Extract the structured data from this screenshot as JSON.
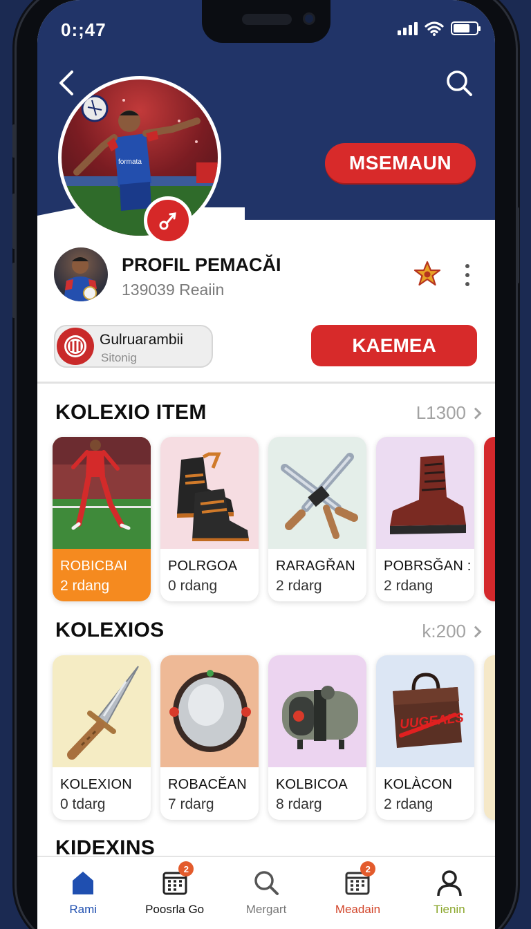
{
  "status_bar": {
    "time": "0:;47"
  },
  "header": {
    "follow_label": "MSEMAUN"
  },
  "profile": {
    "name": "PROFIL PEMACĂI",
    "subtitle": "139039 Reaiin",
    "group_title": "Gulruaгambii",
    "group_subtitle": "Sitonig",
    "primary_action": "KAEMEA"
  },
  "sections": [
    {
      "title": "KOLEXIO ITEM",
      "link": "L1300",
      "items": [
        {
          "name": "ROBICBAI",
          "meta": "2 rdang",
          "icon": "football-player-image"
        },
        {
          "name": "POLRGOA",
          "meta": "0 rdang",
          "icon": "boots-icon"
        },
        {
          "name": "RARAGŘAN",
          "meta": "2 rdarg",
          "icon": "crossed-swords-icon"
        },
        {
          "name": "POBRSĞAN :",
          "meta": "2 rdang",
          "icon": "boot-icon"
        }
      ]
    },
    {
      "title": "KOLEXIOS",
      "link": "k:200",
      "items": [
        {
          "name": "KOLEXION",
          "meta": "0 tdarg",
          "icon": "dagger-icon"
        },
        {
          "name": "ROBACĚAN",
          "meta": "7 rdarg",
          "icon": "shield-icon"
        },
        {
          "name": "KOLBICOA",
          "meta": "8 rdarg",
          "icon": "gadget-icon"
        },
        {
          "name": "KOLÀCON",
          "meta": "2 rdang",
          "icon": "bag-icon"
        }
      ]
    },
    {
      "title": "KIDEXINS"
    }
  ],
  "bag_print": "UUGEALS",
  "bottom_nav": [
    {
      "label": "Rami",
      "color": "#1f4fb0",
      "icon": "home-icon"
    },
    {
      "label": "Poosrla Go",
      "color": "#111111",
      "icon": "calendar-icon",
      "badge": "2"
    },
    {
      "label": "Mergart",
      "color": "#777777",
      "icon": "search-icon"
    },
    {
      "label": "Meadain",
      "color": "#d2452a",
      "icon": "calendar-icon",
      "badge": "2"
    },
    {
      "label": "Tienin",
      "color": "#8aa62a",
      "icon": "user-icon"
    }
  ],
  "colors": {
    "brand_red": "#d82a2a",
    "header_navy": "#213468",
    "highlight_orange": "#f58a1f"
  }
}
